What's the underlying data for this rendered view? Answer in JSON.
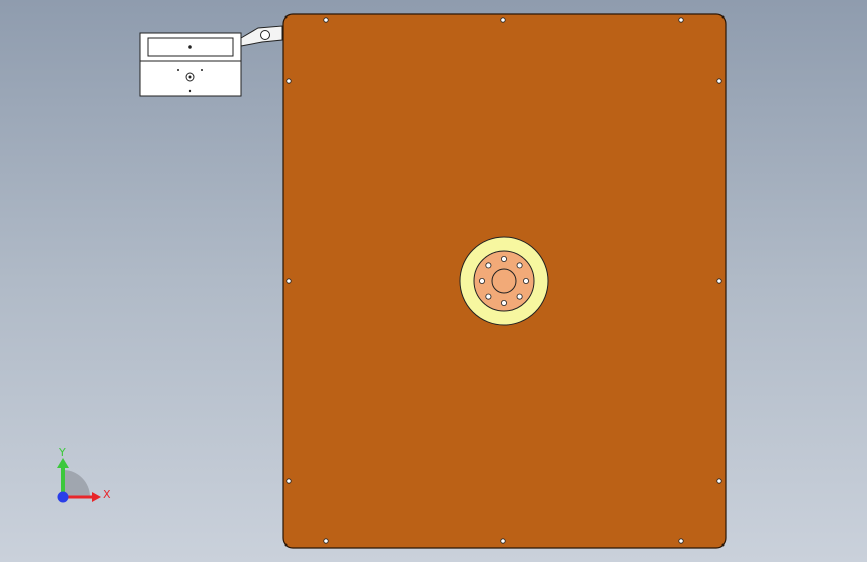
{
  "scene": {
    "plate_color": "#bb6116",
    "plate_edge_color": "#2a1606",
    "ring_outer_color": "#f7f7a0",
    "flange_color": "#f2aa78",
    "bracket_color": "#ffffff",
    "background_top": "#8f9cae",
    "background_bottom": "#c8d0da"
  },
  "triad": {
    "x_label": "X",
    "y_label": "Y",
    "x_color": "#e8262a",
    "y_color": "#3cc83c",
    "z_color": "#2a3ee8"
  },
  "icons": [
    "mount-bracket-icon",
    "flange-icon",
    "coordinate-triad-icon"
  ]
}
